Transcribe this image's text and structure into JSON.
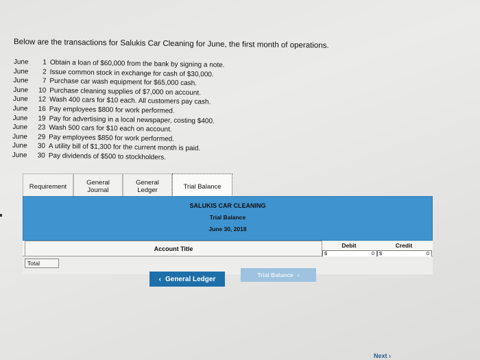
{
  "intro": "Below are the transactions for Salukis Car Cleaning for June, the first month of operations.",
  "transactions": [
    {
      "month": "June",
      "day": "1",
      "text": "Obtain a loan of $60,000 from the bank by signing a note."
    },
    {
      "month": "June",
      "day": "2",
      "text": "Issue common stock in exchange for cash of $30,000."
    },
    {
      "month": "June",
      "day": "7",
      "text": "Purchase car wash equipment for $65,000 cash."
    },
    {
      "month": "June",
      "day": "10",
      "text": "Purchase cleaning supplies of $7,000 on account."
    },
    {
      "month": "June",
      "day": "12",
      "text": "Wash 400 cars for $10 each. All customers pay cash."
    },
    {
      "month": "June",
      "day": "16",
      "text": "Pay employees $800 for work performed."
    },
    {
      "month": "June",
      "day": "19",
      "text": "Pay for advertising in a local newspaper, costing $400."
    },
    {
      "month": "June",
      "day": "23",
      "text": "Wash 500 cars for $10 each on account."
    },
    {
      "month": "June",
      "day": "29",
      "text": "Pay employees $850 for work performed."
    },
    {
      "month": "June",
      "day": "30",
      "text": "A utility bill of $1,300 for the current month is paid."
    },
    {
      "month": "June",
      "day": "30",
      "text": "Pay dividends of $500 to stockholders."
    }
  ],
  "tabs": {
    "requirement": "Requirement",
    "general_journal": "General Journal",
    "general_ledger": "General Ledger",
    "trial_balance": "Trial Balance"
  },
  "trial_balance": {
    "company": "SALUKIS CAR CLEANING",
    "title": "Trial Balance",
    "date": "June 30, 2018",
    "col_account": "Account Title",
    "col_debit": "Debit",
    "col_credit": "Credit",
    "total_label": "Total",
    "debit_currency": "$",
    "debit_total": "0",
    "credit_currency": "$",
    "credit_total": "0"
  },
  "nav": {
    "prev_label": "General Ledger",
    "next_label": "Trial Balance",
    "bottom_next": "Next"
  },
  "colors": {
    "header_blue": "#3f93cf",
    "button_blue": "#1d6fa9",
    "button_disabled": "#9dc3e0"
  }
}
